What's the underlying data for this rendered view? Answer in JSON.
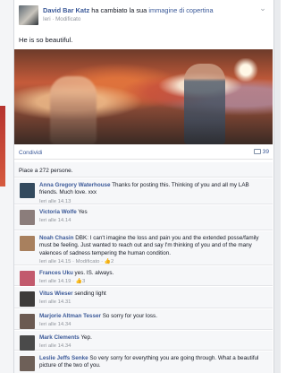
{
  "post": {
    "author": "David Bar Katz",
    "action": "ha cambiato la sua",
    "cover_link": "immagine di copertina",
    "timestamp": "Ieri",
    "edited": "Modificato",
    "status": "He is so beautiful.",
    "share_label": "Condividi",
    "comments_count": "39",
    "likes_text": "Piace a 272 persone."
  },
  "comments": [
    {
      "name": "Anna Gregory Waterhouse",
      "text": "Thanks for posting this. Thinking of you and all my LAB friends. Much love. xxx",
      "meta": "Ieri alle 14.13",
      "avatar_color": "#334a5e"
    },
    {
      "name": "Victoria Wolfe",
      "text": "Yes",
      "meta": "Ieri alle 14.14",
      "avatar_color": "#8b7d7b"
    },
    {
      "name": "Noah Chasin",
      "text": "DBK: I can't imagine the loss and pain you and the extended posse/family must be feeling. Just wanted to reach out and say I'm thinking of you and of the many valences of sadness tempering the human condition.",
      "meta": "Ieri alle 14.15 · Modificato · ",
      "likes": "2",
      "avatar_color": "#a8805e"
    },
    {
      "name": "Frances Uku",
      "text": "yes. IS. always.",
      "meta": "Ieri alle 14.19 · ",
      "likes": "3",
      "avatar_color": "#c25a6d"
    },
    {
      "name": "Vitus Wieser",
      "text": "sending light",
      "meta": "Ieri alle 14.31",
      "avatar_color": "#3d3b3a"
    },
    {
      "name": "Marjorie Altman Tesser",
      "text": "So sorry for your loss.",
      "meta": "Ieri alle 14.34",
      "avatar_color": "#6b5a52"
    },
    {
      "name": "Mark Clements",
      "text": "Yep.",
      "meta": "Ieri alle 14.34",
      "avatar_color": "#4a4a4a"
    },
    {
      "name": "Leslie Jeffs Senke",
      "text": "So very sorry for everything you are going through. What a beautiful picture of the two of you.",
      "meta": "",
      "avatar_color": "#6e6058"
    }
  ]
}
